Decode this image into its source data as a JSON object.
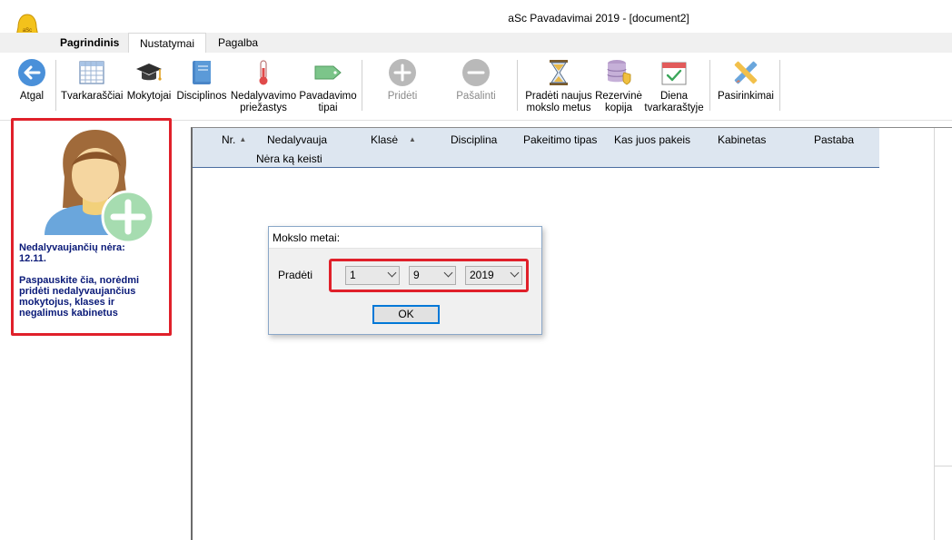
{
  "window": {
    "title": "aSc Pavadavimai 2019  - [document2]",
    "logo_icon": "asc-bell-logo-icon"
  },
  "tabs": [
    {
      "label": "Pagrindinis",
      "active": false
    },
    {
      "label": "Nustatymai",
      "active": true
    },
    {
      "label": "Pagalba",
      "active": false
    }
  ],
  "ribbon": {
    "back": {
      "label": "Atgal",
      "icon": "back-arrow-icon"
    },
    "timetables": {
      "label": "Tvarkaraščiai",
      "icon": "timetable-grid-icon"
    },
    "teachers": {
      "label": "Mokytojai",
      "icon": "graduation-cap-icon"
    },
    "subjects": {
      "label": "Disciplinos",
      "icon": "book-icon"
    },
    "absence_reasons": {
      "label_1": "Nedalyvavimo",
      "label_2": "priežastys",
      "icon": "thermometer-icon"
    },
    "substitution_types": {
      "label_1": "Pavadavimo",
      "label_2": "tipai",
      "icon": "tag-icon"
    },
    "add": {
      "label": "Pridėti",
      "icon": "plus-circle-icon",
      "disabled": true
    },
    "remove": {
      "label": "Pašalinti",
      "icon": "minus-circle-icon",
      "disabled": true
    },
    "new_year": {
      "label_1": "Pradėti naujus",
      "label_2": "mokslo metus",
      "icon": "hourglass-icon"
    },
    "backup": {
      "label_1": "Rezervinė",
      "label_2": "kopija",
      "icon": "database-shield-icon"
    },
    "day_timetable": {
      "label_1": "Diena",
      "label_2": "tvarkaraštyje",
      "icon": "calendar-check-icon"
    },
    "options": {
      "label": "Pasirinkimai",
      "icon": "pencil-ruler-icon"
    }
  },
  "info_card": {
    "line1": "Nedalyvaujančių nėra:",
    "line2": "12.11.",
    "line3": "Paspauskite čia, norėdmi pridėti nedalyvaujančius mokytojus, klases ir negalimus kabinetus",
    "icon": "add-person-icon"
  },
  "grid": {
    "columns": [
      "Nr.",
      "Nedalyvauja",
      "Klasė",
      "Disciplina",
      "Pakeitimo tipas",
      "Kas juos pakeis",
      "Kabinetas",
      "Pastaba"
    ],
    "empty_message": "Nėra ką keisti"
  },
  "dialog": {
    "title": "Mokslo metai:",
    "label": "Pradėti",
    "day": "1",
    "month": "9",
    "year": "2019",
    "ok": "OK"
  }
}
